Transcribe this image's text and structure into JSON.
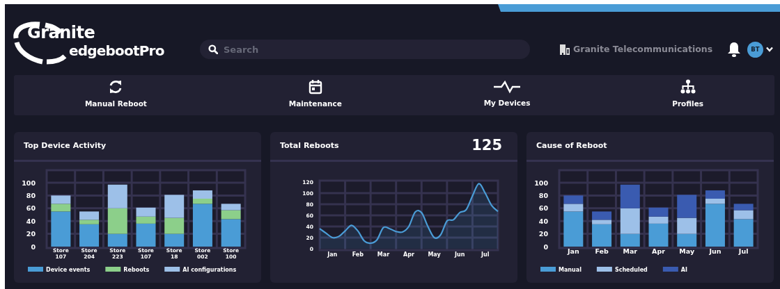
{
  "header": {
    "logo": {
      "top": "Granite",
      "bottom": "edgebootPro"
    },
    "search": {
      "placeholder": "Search"
    },
    "organization": "Granite Telecommunications",
    "user": {
      "initials": "BT"
    }
  },
  "nav": [
    {
      "label": "Manual Reboot"
    },
    {
      "label": "Maintenance"
    },
    {
      "label": "My Devices"
    },
    {
      "label": "Profiles"
    }
  ],
  "cards": [
    {
      "title": "Top Device Activity",
      "chart_data": {
        "type": "bar",
        "stacked": true,
        "categories": [
          "Store 107",
          "Store 204",
          "Store 223",
          "Store 107",
          "Store 18",
          "Store 002",
          "Store 100"
        ],
        "ylim": [
          0,
          100
        ],
        "yticks": [
          0,
          20,
          40,
          60,
          80,
          100
        ],
        "grid": true,
        "legend": true,
        "series": [
          {
            "name": "Device events",
            "color": "#4a9cd6",
            "values": [
              55,
              35,
              20,
              36,
              20,
              67,
              43
            ]
          },
          {
            "name": "Reboots",
            "color": "#8ccf8a",
            "values": [
              12,
              7,
              40,
              11,
              25,
              8,
              14
            ]
          },
          {
            "name": "AI configurations",
            "color": "#9dc0e8",
            "values": [
              13,
              13,
              37,
              14,
              36,
              13,
              10
            ]
          }
        ]
      }
    },
    {
      "title": "Total Reboots",
      "total": "125",
      "chart_data": {
        "type": "area",
        "categories": [
          null,
          null,
          "Jan",
          null,
          null,
          null,
          "Feb",
          null,
          null,
          null,
          "Mar",
          null,
          null,
          null,
          "Apr",
          null,
          null,
          null,
          "May",
          null,
          null,
          null,
          "Jun",
          null,
          null,
          null,
          "Jul",
          null,
          null
        ],
        "ylim": [
          0,
          120
        ],
        "grid": true,
        "yticks": [
          0,
          20,
          40,
          60,
          80,
          100,
          120
        ],
        "series": [
          {
            "color": "#4a9cd6",
            "values": [
              36,
              28,
              20,
              22,
              32,
              42,
              32,
              14,
              10,
              16,
              38,
              36,
              31,
              30,
              40,
              66,
              65,
              40,
              20,
              25,
              50,
              52,
              65,
              70,
              95,
              117,
              100,
              78,
              67
            ]
          }
        ]
      }
    },
    {
      "title": "Cause of Reboot",
      "chart_data": {
        "type": "bar",
        "stacked": true,
        "categories": [
          "Jan",
          "Feb",
          "Mar",
          "Apr",
          "May",
          "Jun",
          "Jul"
        ],
        "ylim": [
          0,
          100
        ],
        "yticks": [
          0,
          20,
          40,
          60,
          80,
          100
        ],
        "grid": true,
        "legend": true,
        "series": [
          {
            "name": "Manual",
            "color": "#4a9cd6",
            "values": [
              55,
              35,
              20,
              36,
              20,
              67,
              43
            ]
          },
          {
            "name": "Scheduled",
            "color": "#9dc0e8",
            "values": [
              12,
              7,
              40,
              11,
              25,
              8,
              14
            ]
          },
          {
            "name": "AI",
            "color": "#3a5bb0",
            "values": [
              13,
              13,
              37,
              14,
              36,
              13,
              10
            ]
          }
        ]
      }
    }
  ]
}
